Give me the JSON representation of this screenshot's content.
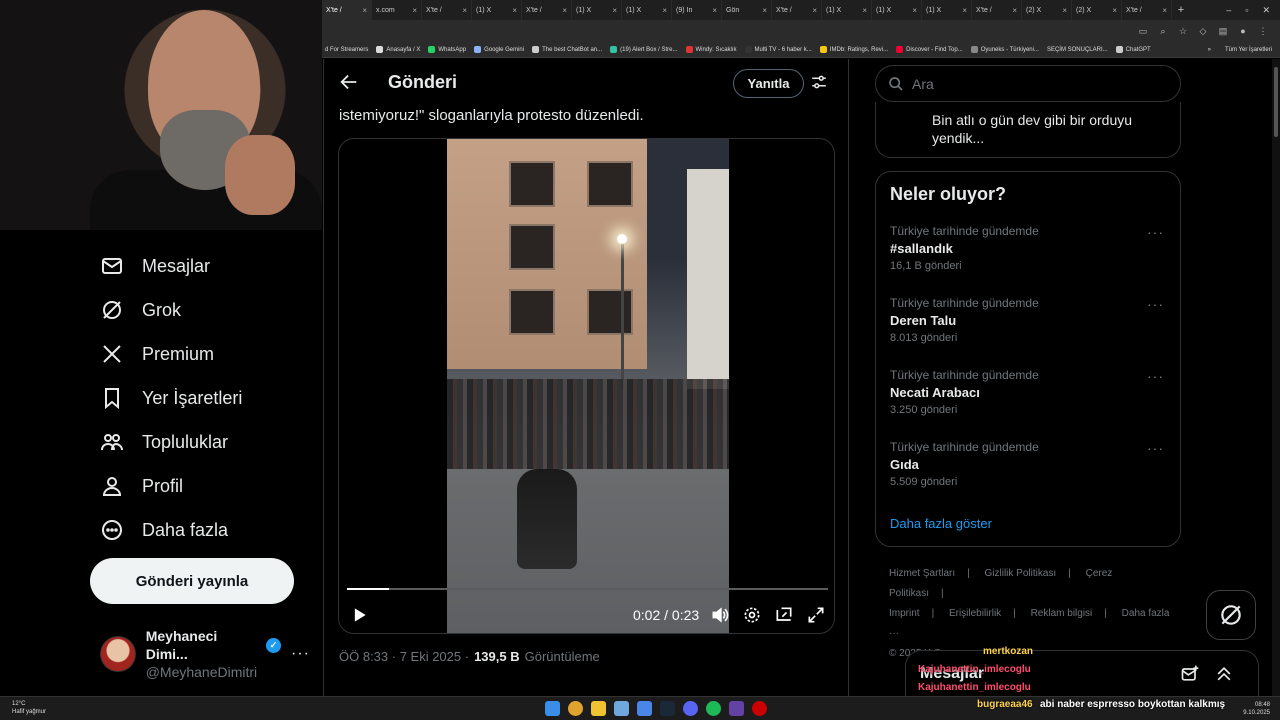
{
  "browser": {
    "tabs": [
      "X'te /",
      "x.com",
      "X'te /",
      "(1) X",
      "X'te /",
      "(1) X",
      "(1) X",
      "(9) In",
      "Gön",
      "X'te /",
      "(1) X",
      "(1) X",
      "(1) X",
      "X'te /",
      "(2) X",
      "(2) X",
      "X'te /"
    ],
    "new_tab": "+",
    "bookmarks": [
      "d For Streamers",
      "Anasayfa / X",
      "WhatsApp",
      "Google Gemini",
      "The best ChatBot an...",
      "(19) Alert Box / Stre...",
      "Windy: Sıcaklık",
      "Multi TV - 6 haber k...",
      "IMDb: Ratings, Revi...",
      "Discover - Find Top...",
      "Oyuneks - Türkiyeni...",
      "SEÇİM SONUÇLARI...",
      "ChatGPT"
    ],
    "bookmarks_more": "»",
    "all_bookmarks": "Tüm Yer İşaretleri"
  },
  "nav": {
    "items": [
      {
        "label": "Mesajlar",
        "icon": "envelope-icon"
      },
      {
        "label": "Grok",
        "icon": "grok-icon"
      },
      {
        "label": "Premium",
        "icon": "x-logo-icon"
      },
      {
        "label": "Yer İşaretleri",
        "icon": "bookmark-icon"
      },
      {
        "label": "Topluluklar",
        "icon": "communities-icon"
      },
      {
        "label": "Profil",
        "icon": "person-icon"
      },
      {
        "label": "Daha fazla",
        "icon": "more-circle-icon"
      }
    ],
    "post_button": "Gönderi yayınla",
    "account": {
      "name": "Meyhaneci Dimi...",
      "handle": "@MeyhaneDimitri",
      "more": "···"
    }
  },
  "post": {
    "header_title": "Gönderi",
    "reply_button": "Yanıtla",
    "text": "istemiyoruz!\" sloganlarıyla protesto düzenledi.",
    "video": {
      "time_current": "0:02",
      "time_separator": "/",
      "time_total": "0:23",
      "progress_fraction": 0.087
    },
    "timestamp": "ÖÖ 8:33 · 7 Eki 2025 ·",
    "views_count": "139,5 B",
    "views_label": "Görüntüleme"
  },
  "sidebar": {
    "search_placeholder": "Ara",
    "quote_text": "Bin atlı o gün dev gibi bir orduyu yendik...",
    "trends_title": "Neler oluyor?",
    "trends": [
      {
        "context": "Türkiye tarihinde gündemde",
        "name": "#sallandık",
        "count": "16,1 B gönderi"
      },
      {
        "context": "Türkiye tarihinde gündemde",
        "name": "Deren Talu",
        "count": "8.013 gönderi"
      },
      {
        "context": "Türkiye tarihinde gündemde",
        "name": "Necati Arabacı",
        "count": "3.250 gönderi"
      },
      {
        "context": "Türkiye tarihinde gündemde",
        "name": "Gıda",
        "count": "5.509 gönderi"
      }
    ],
    "trend_more": "···",
    "show_more": "Daha fazla göster",
    "footer": {
      "line1": [
        "Hizmet Şartları",
        "|",
        "Gizlilik Politikası",
        "|",
        "Çerez Politikası",
        "|"
      ],
      "line2": [
        "Imprint",
        "|",
        "Erişilebilirlik",
        "|",
        "Reklam bilgisi",
        "|",
        "Daha fazla ···"
      ],
      "copyright": "© 2025 X Corp."
    },
    "messages_title": "Mesajlar"
  },
  "stream_chat": [
    {
      "user": "mertkozan",
      "color": "#ffd34d"
    },
    {
      "user": "Kajuhanettin_imlecoglu",
      "color": "#ff4d6d"
    },
    {
      "user": "Kajuhanettin_imlecoglu",
      "color": "#ff4d6d"
    },
    {
      "user": "bugraeaa46",
      "message": "abi naber esprresso boykottan kalkmış",
      "color": "#ffd34d"
    }
  ],
  "taskbar": {
    "weather_temp": "12°C",
    "weather_desc": "Hafif yağmur",
    "time": "08:48",
    "date": "9.10.2025"
  },
  "colors": {
    "accent": "#1d9bf0",
    "background": "#000000",
    "border": "#2f3336",
    "muted_text": "#71767b"
  }
}
